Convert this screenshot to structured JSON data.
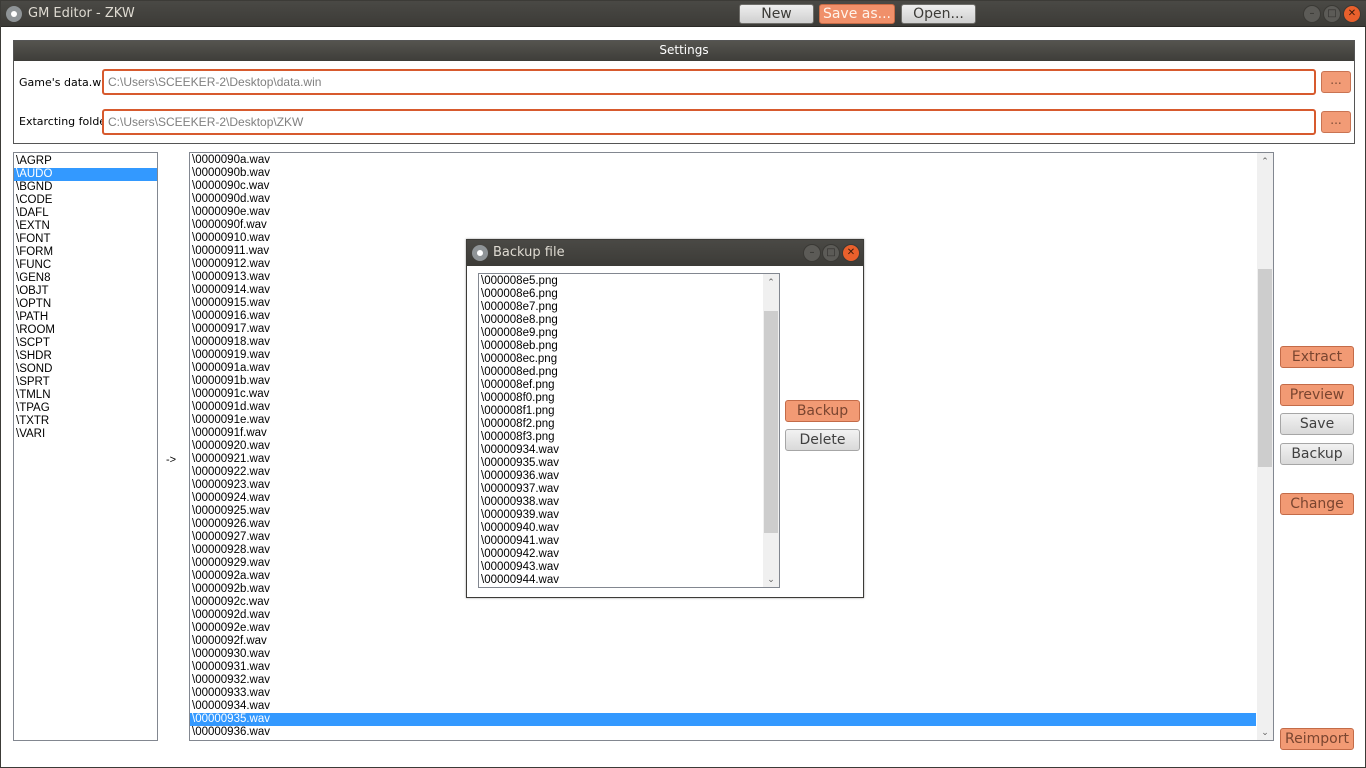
{
  "window": {
    "title": "GM Editor - ZKW",
    "toolbar": {
      "new_label": "New",
      "save_as_label": "Save as...",
      "open_label": "Open..."
    },
    "controls": {
      "minimize": "–",
      "maximize": "□",
      "close": "✕"
    }
  },
  "settings": {
    "header": "Settings",
    "data_win_label": "Game's data.win:",
    "data_win_value": "C:\\Users\\SCEEKER-2\\Desktop\\data.win",
    "extract_label": "Extarcting folder:",
    "extract_value": "C:\\Users\\SCEEKER-2\\Desktop\\ZKW",
    "browse_label": "..."
  },
  "chunks": {
    "items": [
      "\\AGRP",
      "\\AUDO",
      "\\BGND",
      "\\CODE",
      "\\DAFL",
      "\\EXTN",
      "\\FONT",
      "\\FORM",
      "\\FUNC",
      "\\GEN8",
      "\\OBJT",
      "\\OPTN",
      "\\PATH",
      "\\ROOM",
      "\\SCPT",
      "\\SHDR",
      "\\SOND",
      "\\SPRT",
      "\\TMLN",
      "\\TPAG",
      "\\TXTR",
      "\\VARI"
    ],
    "selected_index": 1
  },
  "arrow": "->",
  "files": {
    "items": [
      "\\0000090a.wav",
      "\\0000090b.wav",
      "\\0000090c.wav",
      "\\0000090d.wav",
      "\\0000090e.wav",
      "\\0000090f.wav",
      "\\00000910.wav",
      "\\00000911.wav",
      "\\00000912.wav",
      "\\00000913.wav",
      "\\00000914.wav",
      "\\00000915.wav",
      "\\00000916.wav",
      "\\00000917.wav",
      "\\00000918.wav",
      "\\00000919.wav",
      "\\0000091a.wav",
      "\\0000091b.wav",
      "\\0000091c.wav",
      "\\0000091d.wav",
      "\\0000091e.wav",
      "\\0000091f.wav",
      "\\00000920.wav",
      "\\00000921.wav",
      "\\00000922.wav",
      "\\00000923.wav",
      "\\00000924.wav",
      "\\00000925.wav",
      "\\00000926.wav",
      "\\00000927.wav",
      "\\00000928.wav",
      "\\00000929.wav",
      "\\0000092a.wav",
      "\\0000092b.wav",
      "\\0000092c.wav",
      "\\0000092d.wav",
      "\\0000092e.wav",
      "\\0000092f.wav",
      "\\00000930.wav",
      "\\00000931.wav",
      "\\00000932.wav",
      "\\00000933.wav",
      "\\00000934.wav",
      "\\00000935.wav",
      "\\00000936.wav"
    ],
    "selected_index": 43
  },
  "actions": {
    "extract": "Extract",
    "preview": "Preview",
    "save": "Save",
    "backup": "Backup",
    "change": "Change",
    "reimport": "Reimport"
  },
  "dialog": {
    "title": "Backup file",
    "items": [
      "\\000008e5.png",
      "\\000008e6.png",
      "\\000008e7.png",
      "\\000008e8.png",
      "\\000008e9.png",
      "\\000008eb.png",
      "\\000008ec.png",
      "\\000008ed.png",
      "\\000008ef.png",
      "\\000008f0.png",
      "\\000008f1.png",
      "\\000008f2.png",
      "\\000008f3.png",
      "\\00000934.wav",
      "\\00000935.wav",
      "\\00000936.wav",
      "\\00000937.wav",
      "\\00000938.wav",
      "\\00000939.wav",
      "\\00000940.wav",
      "\\00000941.wav",
      "\\00000942.wav",
      "\\00000943.wav",
      "\\00000944.wav"
    ],
    "backup_label": "Backup",
    "delete_label": "Delete"
  },
  "icons": {
    "scroll_up": "⌃",
    "scroll_down": "⌄"
  }
}
